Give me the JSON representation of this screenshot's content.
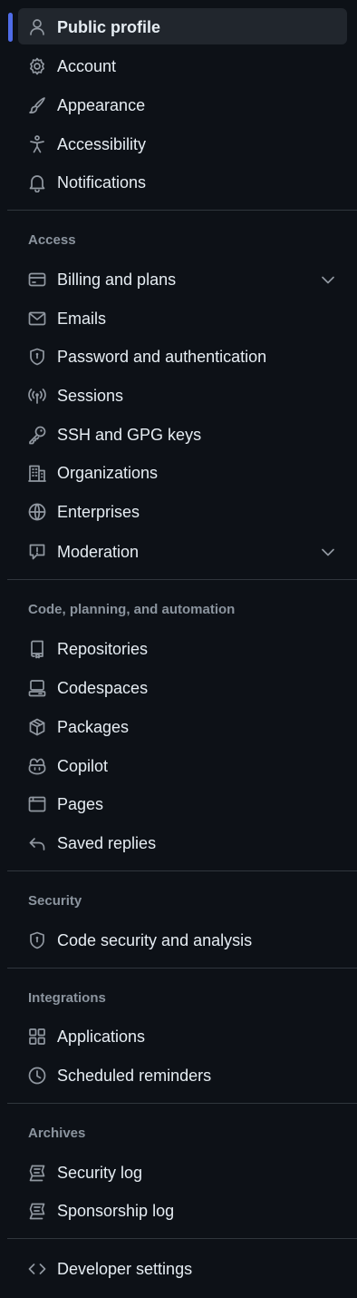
{
  "nav": {
    "top_items": [
      {
        "label": "Public profile",
        "icon": "person-icon",
        "active": true
      },
      {
        "label": "Account",
        "icon": "gear-icon"
      },
      {
        "label": "Appearance",
        "icon": "paintbrush-icon"
      },
      {
        "label": "Accessibility",
        "icon": "accessibility-icon"
      },
      {
        "label": "Notifications",
        "icon": "bell-icon"
      }
    ],
    "access": {
      "heading": "Access",
      "items": [
        {
          "label": "Billing and plans",
          "icon": "credit-card-icon",
          "expandable": true
        },
        {
          "label": "Emails",
          "icon": "mail-icon"
        },
        {
          "label": "Password and authentication",
          "icon": "shield-lock-icon"
        },
        {
          "label": "Sessions",
          "icon": "broadcast-icon"
        },
        {
          "label": "SSH and GPG keys",
          "icon": "key-icon"
        },
        {
          "label": "Organizations",
          "icon": "organization-icon"
        },
        {
          "label": "Enterprises",
          "icon": "globe-icon"
        },
        {
          "label": "Moderation",
          "icon": "report-icon",
          "expandable": true
        }
      ]
    },
    "code": {
      "heading": "Code, planning, and automation",
      "items": [
        {
          "label": "Repositories",
          "icon": "repo-icon"
        },
        {
          "label": "Codespaces",
          "icon": "codespaces-icon"
        },
        {
          "label": "Packages",
          "icon": "package-icon"
        },
        {
          "label": "Copilot",
          "icon": "copilot-icon"
        },
        {
          "label": "Pages",
          "icon": "browser-icon"
        },
        {
          "label": "Saved replies",
          "icon": "reply-icon"
        }
      ]
    },
    "security": {
      "heading": "Security",
      "items": [
        {
          "label": "Code security and analysis",
          "icon": "shield-lock-icon"
        }
      ]
    },
    "integrations": {
      "heading": "Integrations",
      "items": [
        {
          "label": "Applications",
          "icon": "apps-icon"
        },
        {
          "label": "Scheduled reminders",
          "icon": "clock-icon"
        }
      ]
    },
    "archives": {
      "heading": "Archives",
      "items": [
        {
          "label": "Security log",
          "icon": "log-icon"
        },
        {
          "label": "Sponsorship log",
          "icon": "log-icon"
        }
      ]
    },
    "developer": {
      "label": "Developer settings",
      "icon": "code-icon"
    }
  },
  "colors": {
    "background": "#0d1117",
    "active_bg": "#21262d",
    "accent": "#4f6ce8",
    "text": "#e6edf3",
    "muted": "#8b949e",
    "icon": "#9198a1",
    "divider": "#30363d"
  }
}
